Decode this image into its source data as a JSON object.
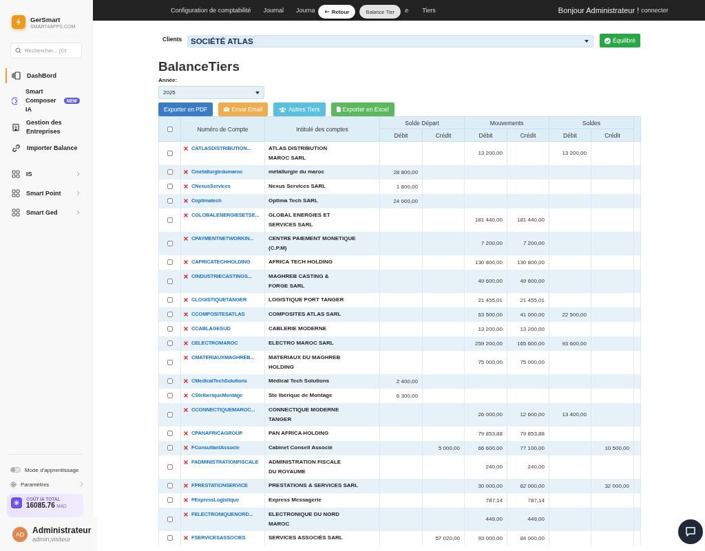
{
  "sidebar": {
    "brand": {
      "name": "GerSmart",
      "domain": "SMART4APPS.COM"
    },
    "search": {
      "placeholder": "Rechercher... (Ct"
    },
    "items": [
      {
        "label": "DashBord",
        "kind": "link",
        "selected": true
      },
      {
        "label": "Smart Composer IA",
        "kind": "link",
        "selected": false,
        "badge": "NEW"
      },
      {
        "label": "Gestion des Entreprises",
        "kind": "link",
        "selected": false
      },
      {
        "label": "Importer Balance",
        "kind": "link",
        "selected": false
      },
      {
        "label": "IS",
        "kind": "group",
        "selected": false
      },
      {
        "label": "Smart Point",
        "kind": "group",
        "selected": false
      },
      {
        "label": "Smart Ged",
        "kind": "group",
        "selected": false
      }
    ],
    "learning_mode": {
      "label": "Mode d'apprentissage",
      "on": false
    },
    "settings": "Paramètres",
    "cost": {
      "label": "COÛT IA TOTAL",
      "value": "16085.76",
      "unit": "MAD"
    },
    "user": {
      "initials": "AD",
      "name": "Administrateur",
      "roles": "admin,visiteur"
    }
  },
  "topbar": {
    "links": [
      "Configuration de comptabilité",
      "Journal",
      "Journa"
    ],
    "back": "Retour",
    "pill": "Balance Tier",
    "after": [
      "e",
      "Tiers"
    ],
    "greeting": "Bonjour Administrateur !",
    "logout": "connecter"
  },
  "client": {
    "label": "Clients",
    "value": "SOCIÉTÉ ATLAS",
    "status": "Équilibré"
  },
  "title": "BalanceTiers",
  "year": {
    "label": "Année:",
    "value": "2025"
  },
  "actions": [
    {
      "label": "Exporter en PDF",
      "kind": "pdf"
    },
    {
      "label": "Envoi Email",
      "kind": "email"
    },
    {
      "label": "Autres Tiers",
      "kind": "tiers"
    },
    {
      "label": "Exporter en Excel",
      "kind": "excel"
    }
  ],
  "table": {
    "select_all_checked": false,
    "columns": [
      "Numéro de Compte",
      "Intitulé des comptes"
    ],
    "groups": [
      {
        "label": "Solde Départ",
        "subcolumns": [
          "Débit",
          "Crédit"
        ]
      },
      {
        "label": "Mouvements",
        "subcolumns": [
          "Débit",
          "Crédit"
        ]
      },
      {
        "label": "Soldes",
        "subcolumns": [
          "Débit",
          "Crédit"
        ]
      }
    ],
    "rows": [
      {
        "checked": false,
        "account": "CATLASDISTRIBUTION...",
        "name": "ATLAS DISTRIBUTION\nMAROC SARL",
        "amounts": {
          "mouvements_debit": "13 200,00",
          "soldes_debit": "13 200,00"
        }
      },
      {
        "checked": false,
        "account": "Cmetallurgiedumaroc",
        "name": "métallurgie du maroc",
        "amounts": {
          "depart_debit": "28 800,00"
        }
      },
      {
        "checked": false,
        "account": "CNexusServices",
        "name": "Nexus Services SARL",
        "amounts": {
          "depart_debit": "1 800,00"
        }
      },
      {
        "checked": false,
        "account": "Coptimatech",
        "name": "Optima Tech SARL",
        "amounts": {
          "depart_debit": "24 000,00"
        }
      },
      {
        "checked": false,
        "account": "CGLOBALENERGIESETSE...",
        "name": "GLOBAL ENERGIES ET\nSERVICES SARL",
        "amounts": {
          "mouvements_debit": "181 440,00",
          "mouvements_credit": "181 440,00"
        }
      },
      {
        "checked": false,
        "account": "CPAYMENTNETWORKIN...",
        "name": "CENTRE PAIEMENT MONETIQUE\n(C.P.M)",
        "amounts": {
          "mouvements_debit": "7 200,00",
          "mouvements_credit": "7 200,00"
        }
      },
      {
        "checked": false,
        "account": "CAFRICATECHHOLDING",
        "name": "AFRICA TECH HOLDING",
        "amounts": {
          "mouvements_debit": "130 800,00",
          "mouvements_credit": "130 800,00"
        }
      },
      {
        "checked": false,
        "account": "CINDUSTRIECASTINGS...",
        "name": "MAGHREB CASTING &\nFORGE SARL",
        "amounts": {
          "mouvements_debit": "49 600,00",
          "mouvements_credit": "49 600,00"
        }
      },
      {
        "checked": false,
        "account": "CLOGISTIQUETANGER",
        "name": "LOGISTIQUE PORT TANGER",
        "amounts": {
          "mouvements_debit": "21 455,01",
          "mouvements_credit": "21 455,01"
        }
      },
      {
        "checked": false,
        "account": "CCOMPOSITESATLAS",
        "name": "COMPOSITES ATLAS SARL",
        "amounts": {
          "mouvements_debit": "63 500,00",
          "mouvements_credit": "41 000,00",
          "soldes_debit": "22 500,00"
        }
      },
      {
        "checked": false,
        "account": "CCABLAGESUD",
        "name": "CABLERIE MODERNE",
        "amounts": {
          "mouvements_debit": "13 200,00",
          "mouvements_credit": "13 200,00"
        }
      },
      {
        "checked": false,
        "account": "CELECTROMAROC",
        "name": "ELECTRO MAROC SARL",
        "amounts": {
          "mouvements_debit": "259 200,00",
          "mouvements_credit": "165 600,00",
          "soldes_debit": "93 600,00"
        }
      },
      {
        "checked": false,
        "account": "CMATERIAUXMAGHREB...",
        "name": "MATERIAUX DU MAGHREB\nHOLDING",
        "amounts": {
          "mouvements_debit": "75 000,00",
          "mouvements_credit": "75 000,00"
        }
      },
      {
        "checked": false,
        "account": "CMedicalTechSolutions",
        "name": "Médical Tech Solutions",
        "amounts": {
          "depart_debit": "2 400,00"
        }
      },
      {
        "checked": false,
        "account": "CStelberiqueMontage",
        "name": "Ste Ibérique de Montage",
        "amounts": {
          "depart_debit": "6 300,00"
        }
      },
      {
        "checked": false,
        "account": "CCONNECTIQUEMAROC...",
        "name": "CONNECTIQUE MODERNE\nTANGER",
        "amounts": {
          "mouvements_debit": "26 000,00",
          "mouvements_credit": "12 600,00",
          "soldes_debit": "13 400,00"
        }
      },
      {
        "checked": false,
        "account": "CPANAFRICAGROUP",
        "name": "PAN AFRICA HOLDING",
        "amounts": {
          "mouvements_debit": "79 853,88",
          "mouvements_credit": "79 853,88"
        }
      },
      {
        "checked": false,
        "account": "FConsultantAssocie",
        "name": "Cabinet Conseil Associé",
        "amounts": {
          "depart_credit": "5 000,00",
          "mouvements_debit": "66 600,00",
          "mouvements_credit": "77 100,00",
          "soldes_credit": "10 500,00"
        }
      },
      {
        "checked": false,
        "account": "FADMINISTRATIONFISCALE",
        "name": "ADMINISTRATION FISCALE\nDU ROYAUME",
        "amounts": {
          "mouvements_debit": "240,00",
          "mouvements_credit": "240,00"
        }
      },
      {
        "checked": false,
        "account": "FPRESTATIONSERVICE",
        "name": "PRESTATIONS & SERVICES SARL",
        "amounts": {
          "mouvements_debit": "30 000,00",
          "mouvements_credit": "62 000,00",
          "soldes_credit": "32 000,00"
        }
      },
      {
        "checked": false,
        "account": "FExpressLogistique",
        "name": "Express Messagerie",
        "amounts": {
          "mouvements_debit": "787,14",
          "mouvements_credit": "787,14"
        }
      },
      {
        "checked": false,
        "account": "FELECTRONIQUENORD...",
        "name": "ELECTRONIQUE DU NORD\nMAROC",
        "amounts": {
          "mouvements_debit": "449,00",
          "mouvements_credit": "449,00"
        }
      },
      {
        "checked": false,
        "account": "FSERVICESASSOCIES",
        "name": "SERVICES ASSOCIÉS SARL",
        "amounts": {
          "depart_credit": "57 020,00",
          "mouvements_debit": "93 000,00",
          "mouvements_credit": "84 000,00"
        }
      }
    ]
  }
}
